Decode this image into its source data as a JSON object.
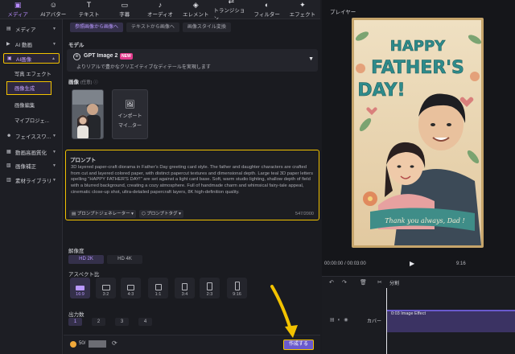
{
  "toolbar": {
    "items": [
      {
        "label": "メディア",
        "icon": "media-icon",
        "active": true
      },
      {
        "label": "AIアバター",
        "icon": "avatar-icon"
      },
      {
        "label": "テキスト",
        "icon": "text-icon"
      },
      {
        "label": "字幕",
        "icon": "subtitle-icon"
      },
      {
        "label": "オーディオ",
        "icon": "audio-icon"
      },
      {
        "label": "エレメント",
        "icon": "element-icon"
      },
      {
        "label": "トランジション",
        "icon": "transition-icon"
      },
      {
        "label": "フィルター",
        "icon": "filter-icon"
      },
      {
        "label": "エフェクト",
        "icon": "effect-icon"
      }
    ]
  },
  "sidebar": {
    "items": [
      {
        "label": "メディア"
      },
      {
        "label": "AI 動画"
      },
      {
        "label": "AI画像"
      },
      {
        "label": "フェイススワ..."
      },
      {
        "label": "動画高画質化"
      },
      {
        "label": "画像補正"
      },
      {
        "label": "素材ライブラリ"
      }
    ],
    "sub": [
      "写真 エフェクト",
      "画像生成",
      "画像編集",
      "マイプロジェ..."
    ]
  },
  "panel": {
    "tabs": [
      "参照画像から画像へ",
      "テキストから画像へ",
      "画像スタイル変換"
    ],
    "model_label": "モデル",
    "model_name": "GPT Image 2",
    "model_badge": "NEW",
    "model_desc": "よりリアルで豊かなクリエイティブなディテールを実現します",
    "image_label": "画像",
    "image_optional": "(任意)",
    "import_label_1": "インポート",
    "import_label_2": "マイ...ター",
    "prompt_label": "プロンプト",
    "prompt_text": "3D layered paper-craft diorama in Father's Day greeting card style. The father and daughter characters are crafted from cut and layered colored paper, with distinct papercut textures and dimensional depth. Large teal 3D paper letters spelling \"HAPPY FATHER'S DAY!\" are set against a light card base. Soft, warm studio lighting, shallow depth of field with a blurred background, creating a cozy atmosphere. Full of handmade charm and whimsical fairy-tale appeal, cinematic close-up shot, ultra-detailed papercraft layers, 8K high-definition quality.",
    "prompt_gen_btn": "プロンプトジェネレーター",
    "prompt_tag_btn": "プロンプトタグ",
    "prompt_count": "547/2000",
    "resolution_label": "解像度",
    "resolutions": [
      "HD 2K",
      "HD 4K"
    ],
    "aspect_label": "アスペクト比",
    "aspects": [
      "16:9",
      "3:2",
      "4:3",
      "1:1",
      "3:4",
      "2:3",
      "9:16"
    ],
    "count_label": "出力数",
    "counts": [
      "1",
      "2",
      "3",
      "4"
    ],
    "credit": "50/",
    "generate_btn": "作成する"
  },
  "player": {
    "title": "プレイヤー",
    "timecode": "00:00:00 / 00:03:00",
    "zoom": "9:16",
    "card_title_1": "HAPPY",
    "card_title_2": "FATHER'S",
    "card_title_3": "DAY!",
    "card_ribbon": "Thank you always, Dad !"
  },
  "timeline": {
    "split_label": "分割",
    "track_label": "カバー",
    "clip_label": "0:03 Image Effect"
  },
  "colors": {
    "accent": "#b98cff",
    "highlight": "#f2c200",
    "button": "#6a5acd"
  }
}
